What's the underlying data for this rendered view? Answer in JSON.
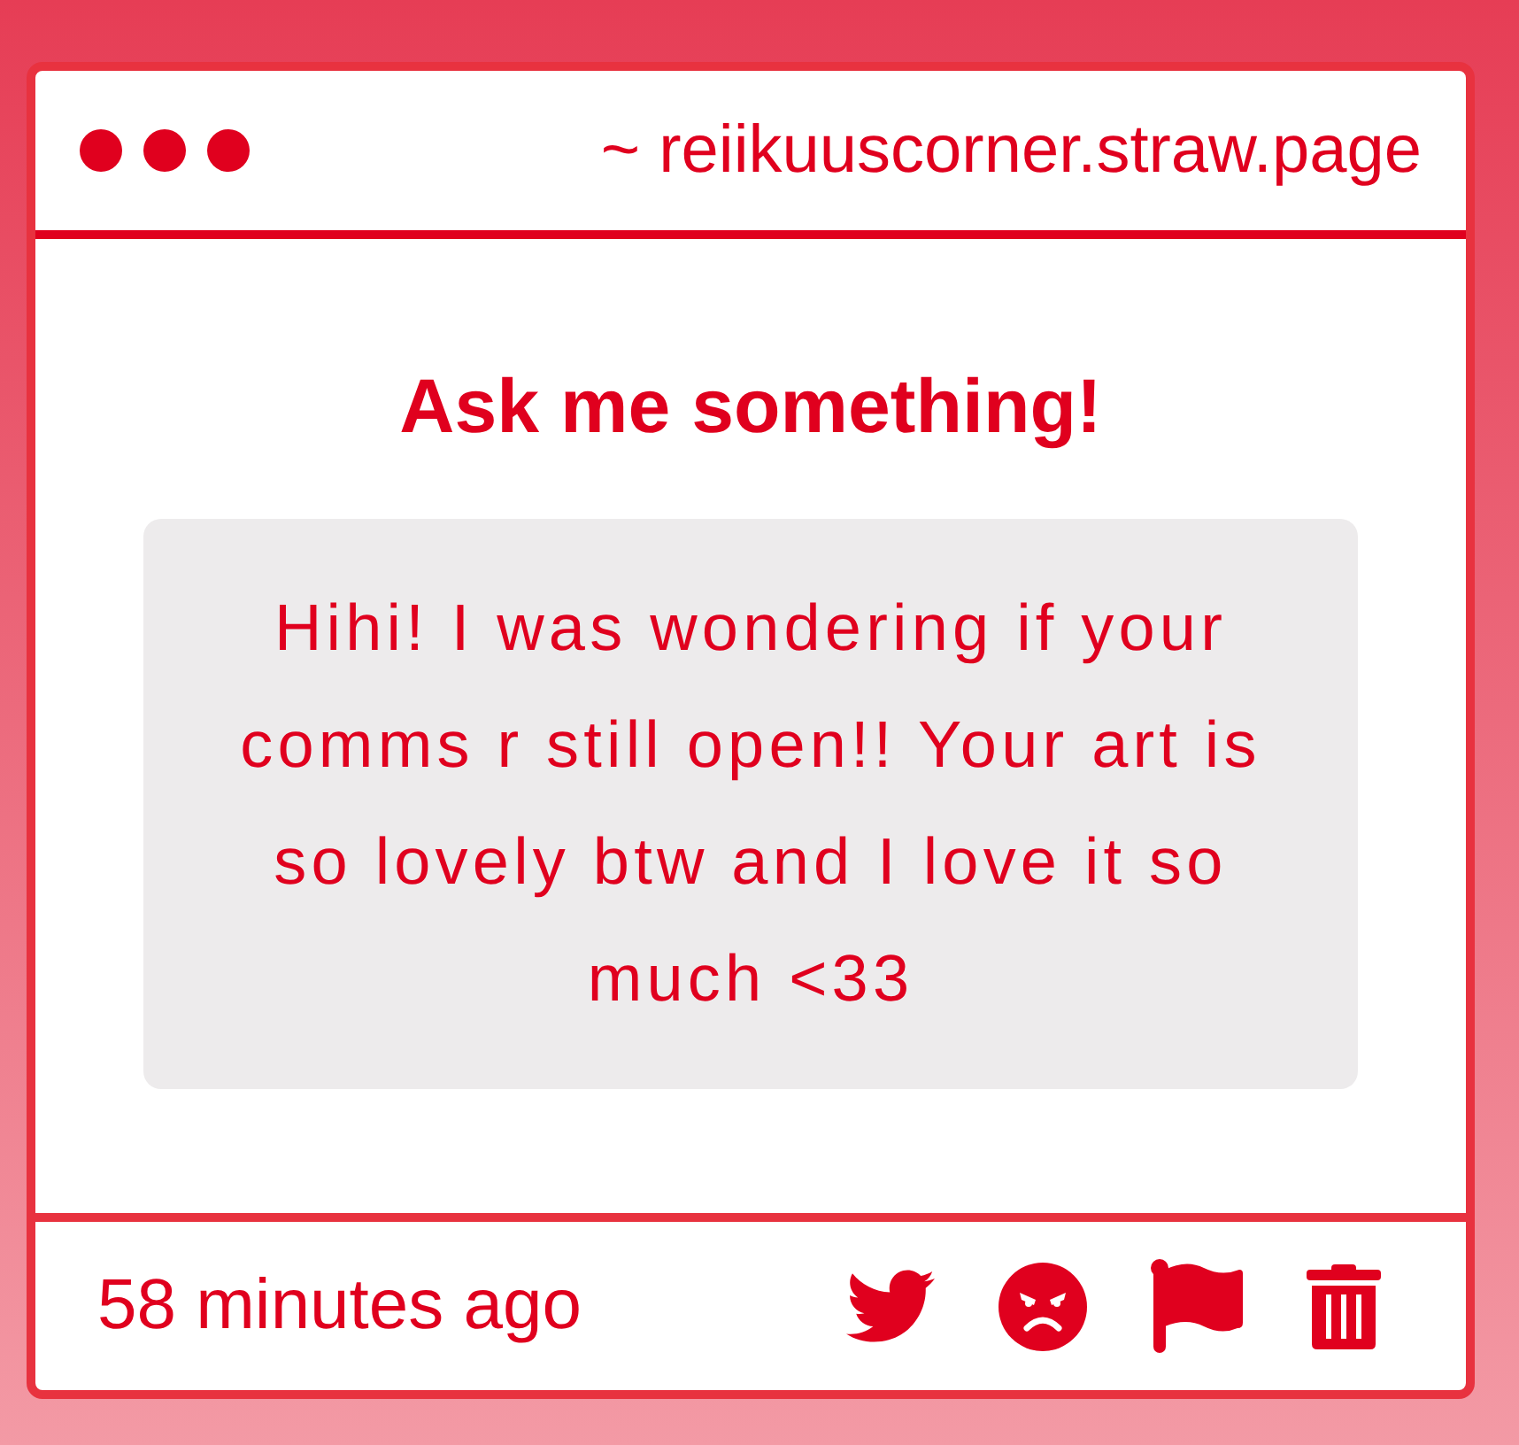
{
  "browser_bar": {
    "url": "~ reiikuuscorner.straw.page"
  },
  "question": {
    "title": "Ask me something!",
    "message": "Hihi! I was wondering if your comms r still open!! Your art is so lovely btw and I love it so much <33"
  },
  "footer": {
    "timestamp": "58 minutes ago"
  }
}
